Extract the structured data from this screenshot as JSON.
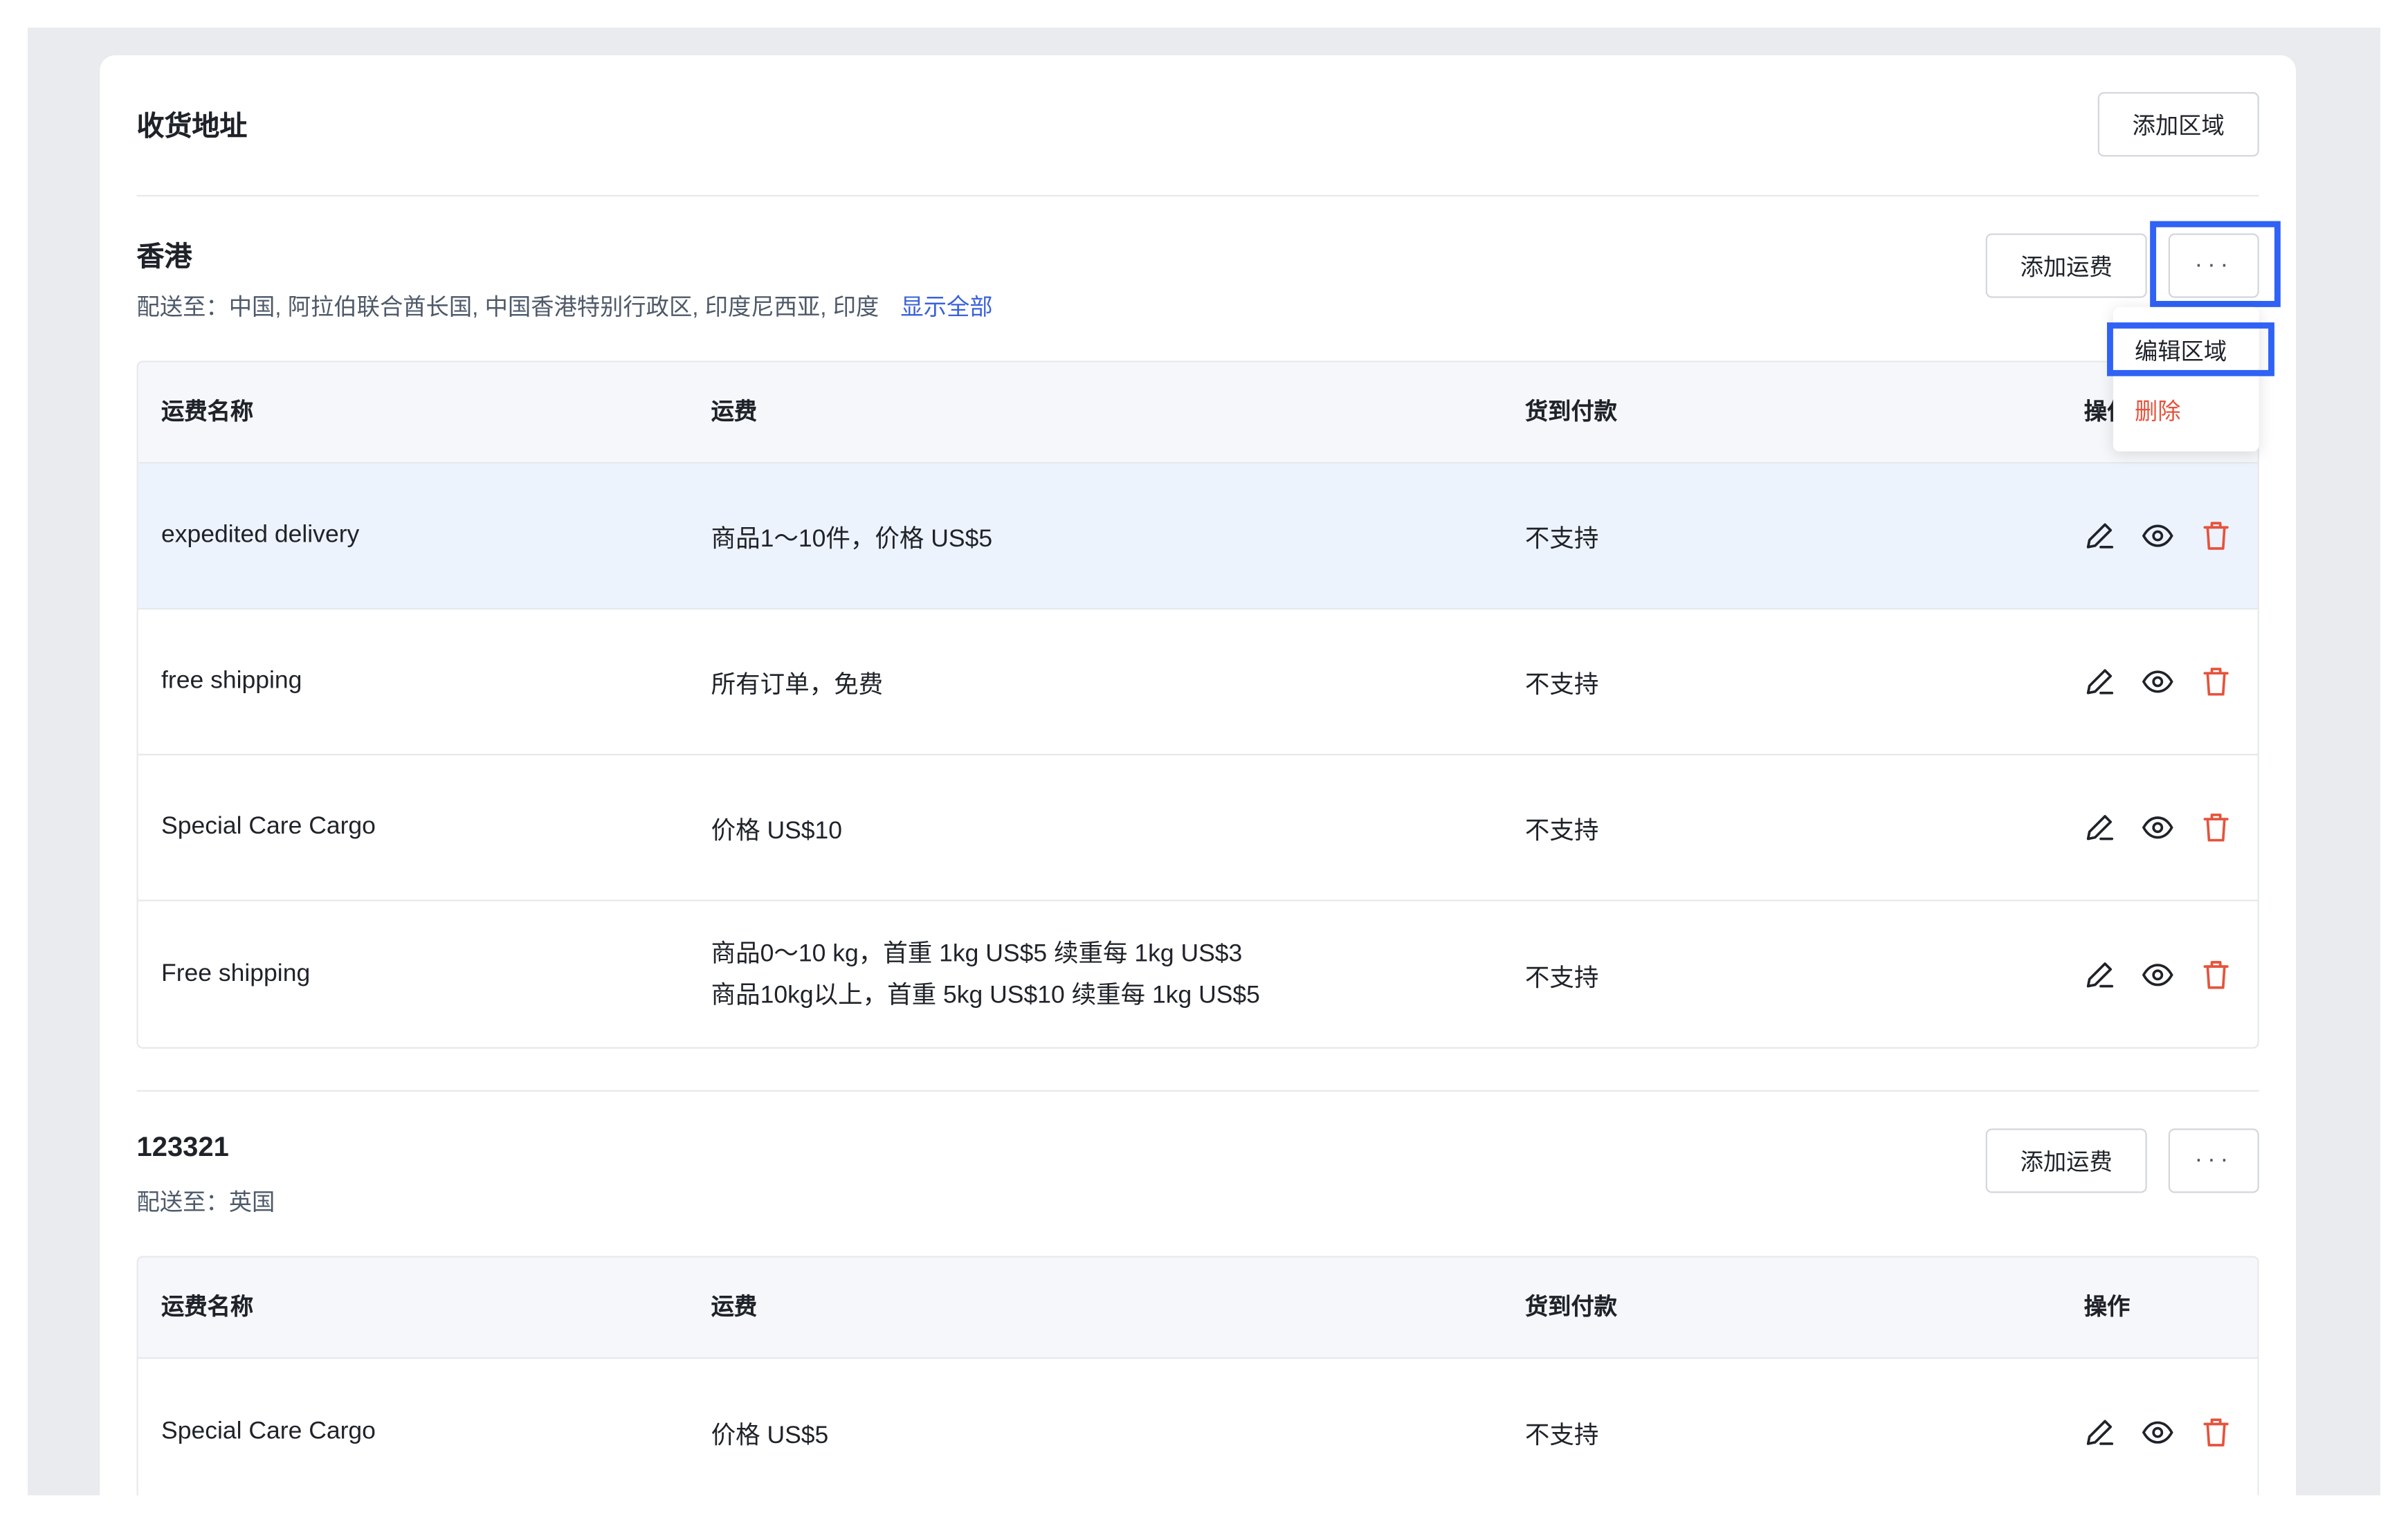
{
  "page": {
    "title": "收货地址",
    "add_zone_label": "添加区域"
  },
  "zones": [
    {
      "name": "香港",
      "dest_prefix": "配送至：",
      "dest_list": "中国, 阿拉伯联合酋长国, 中国香港特别行政区, 印度尼西亚, 印度",
      "show_all_label": "显示全部",
      "add_rate_label": "添加运费",
      "more_label": "···",
      "columns": [
        "运费名称",
        "运费",
        "货到付款",
        "操作"
      ],
      "rows": [
        {
          "name": "expedited delivery",
          "fee": [
            "商品1～10件，价格 US$5"
          ],
          "cod": "不支持"
        },
        {
          "name": "free shipping",
          "fee": [
            "所有订单，免费"
          ],
          "cod": "不支持"
        },
        {
          "name": "Special Care Cargo",
          "fee": [
            "价格 US$10"
          ],
          "cod": "不支持"
        },
        {
          "name": "Free shipping",
          "fee": [
            "商品0～10 kg，首重 1kg US$5  续重每 1kg US$3",
            "商品10kg以上，首重 5kg US$10  续重每 1kg US$5"
          ],
          "cod": "不支持"
        }
      ]
    },
    {
      "name": "123321",
      "dest_prefix": "配送至：",
      "dest_list": "英国",
      "add_rate_label": "添加运费",
      "more_label": "···",
      "columns": [
        "运费名称",
        "运费",
        "货到付款",
        "操作"
      ],
      "rows": [
        {
          "name": "Special Care Cargo",
          "fee": [
            "价格 US$5"
          ],
          "cod": "不支持"
        }
      ]
    }
  ],
  "dropdown": {
    "edit_zone_label": "编辑区域",
    "delete_label": "删除"
  },
  "icons": {
    "edit": "pencil-icon",
    "view": "eye-icon",
    "delete": "trash-icon"
  },
  "colors": {
    "link": "#3a62d8",
    "danger": "#e5533c",
    "highlight_box": "#2f62f5",
    "row_highlight": "#edf3fc"
  }
}
